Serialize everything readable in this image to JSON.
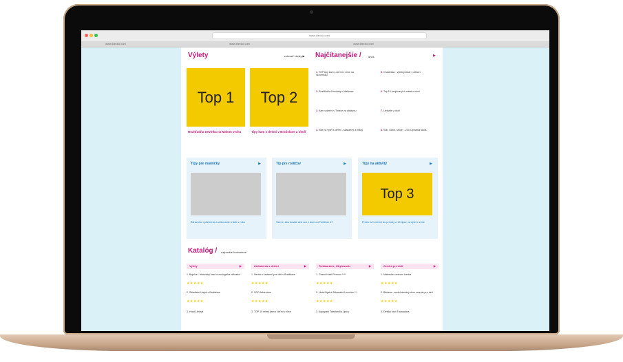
{
  "browser": {
    "url": "www.idecko.com",
    "tabs": [
      "www.idecko.com",
      "www.idecko.com",
      "www.idecko.com"
    ]
  },
  "vylety": {
    "title": "Výlety",
    "more_link": "zobraziť všetky ▶",
    "top1": "Top 1",
    "top2": "Top 2",
    "top1_caption": "Rozhľadňa Devínka na Malom vrchu",
    "top2_caption": "Tipy kam s deťmi v Bratislave a okolí"
  },
  "najcitanejsie": {
    "title": "Najčítanejšie /",
    "subtitle": "dnes",
    "items": [
      {
        "num": "1.",
        "text": "TOP tipy kam s deťmi v zime na Slovensku"
      },
      {
        "num": "2.",
        "text": "Rozhľadňa Hrnsiaky v Malinove"
      },
      {
        "num": "3.",
        "text": "Kam s deťmi v Trnave za zábavou"
      },
      {
        "num": "4.",
        "text": "Kde na výlet s deťmi - skanzeny a hrady"
      },
      {
        "num": "5.",
        "text": "Chatárska - výletný lekár v Záhorí"
      },
      {
        "num": "6.",
        "text": "Top 10 zaujímavých miest v okolí"
      },
      {
        "num": "7.",
        "text": "Lietanie v okolí"
      },
      {
        "num": "8.",
        "text": "Sob, sobík, stroje... Zoo Lipovská škola"
      }
    ]
  },
  "cards": [
    {
      "title": "Tipy pre mamičky",
      "arrow": "▶",
      "text": "Zdravotné vyšetrenia a očkovanie u detí v roku"
    },
    {
      "title": "Tip pre rodičov",
      "arrow": "▶",
      "text": "Vieme, ako dostať deti von z domu a Trebišov 17"
    },
    {
      "title": "Tipy na aktivity",
      "arrow": "▶",
      "top3": "Top 3",
      "text": "Prečo ísť s deťmi do prírody a 10 tipov na výlet v zime"
    }
  ],
  "katalog": {
    "title": "Katalóg /",
    "subtitle": "najnovšie hodnotené",
    "columns": [
      {
        "head": "Výlety",
        "arrow": "▶",
        "items": [
          {
            "num": "1.",
            "text": "Bojnice - historický hrad a zoologická záhrada"
          },
          {
            "num": "2.",
            "text": "Skladisko Hajok v Bratislave"
          },
          {
            "num": "3.",
            "text": "Hrad Lietava"
          }
        ]
      },
      {
        "head": "Zariadenia s deťmi",
        "arrow": "▶",
        "items": [
          {
            "num": "1.",
            "text": "Herňa a kaviareň pre deti v Bratislave"
          },
          {
            "num": "2.",
            "text": "ZOO Adventure"
          },
          {
            "num": "3.",
            "text": "TOP 10 miest kam s deťmi v zime"
          }
        ]
      },
      {
        "head": "Reštaurácie, Ubytovanie",
        "arrow": "▶",
        "items": [
          {
            "num": "1.",
            "text": "Grand Hotel Permon ****"
          },
          {
            "num": "2.",
            "text": "Hotel Bystrá Tatranská Lomnica ***"
          },
          {
            "num": "3.",
            "text": "Aquapark Tatralandia Liptov"
          }
        ]
      },
      {
        "head": "Centrá pre deti",
        "arrow": "▶",
        "items": [
          {
            "num": "1.",
            "text": "Materské centrum Lienka"
          },
          {
            "num": "2.",
            "text": "Bibiana - medzinárodný dom umenia pre deti"
          },
          {
            "num": "3.",
            "text": "Detský klub Trampolína"
          }
        ]
      }
    ],
    "stars": "★★★★★"
  }
}
